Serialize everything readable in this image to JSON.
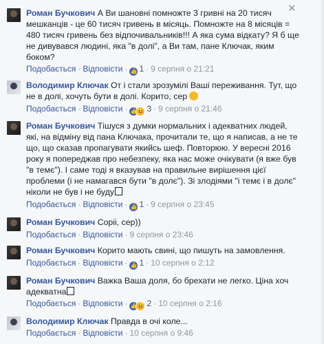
{
  "labels": {
    "like": "Подобається",
    "reply": "Відповісти"
  },
  "comments": [
    {
      "author": "Роман Бучкович",
      "text": "А Ви шановні помножте 3 гривні на 20 тисяч мешканців - це 60 тисяч гривень в місяць. Помножте на 8 місяців = 480 тисяч гривень без відпочивальників!!! А яка сума відкату? Я б ще не дивувався людині, яка \"в долі\", а Ви там, пане Ключак, яким боком?",
      "likes": "1",
      "time": "9 серпня о 21:21"
    },
    {
      "author": "Володимир Ключак",
      "text": "От і стали зрозумілі Ваші переживання. Тут, що не в долі, хочуть бути в долі. Корито, сер",
      "likes": "3",
      "time": "9 серпня о 21:46"
    },
    {
      "author": "Роман Бучкович",
      "text": "Тішуся з думки нормальних і адекватних людей, які, на відміну від пана Ключака, прочитали те, що я написав, а не те що, що сказав пропагувати якийсь шеф. Повторюю. У вересні 2016 року я попереджав про небезпеку, яка нас може очікувати (я вже був \"в темє\"). І саме тоді я вказував на правильне вирішення цієї проблеми (і не намагався бути \"в долє\"). Зі злодіями \"і темє і в долє\" ніколи не був і не буду",
      "likes": "1",
      "time": "9 серпня о 23:45"
    },
    {
      "author": "Роман Бучкович",
      "text": "Copii, сер))",
      "likes": "",
      "time": "9 серпня о 23:46"
    },
    {
      "author": "Роман Бучкович",
      "text": "Корито мають свині, що пишуть на замовлення.",
      "likes": "1",
      "time": "10 серпня о 2:12"
    },
    {
      "author": "Роман Бучкович",
      "text": "Важка Ваша доля, бо брехати не легко. Ціна хоч адекватна",
      "likes": "2",
      "time": "10 серпня о 2:16"
    },
    {
      "author": "Володимир Ключак",
      "text": "Правда в очі коле...",
      "likes": "",
      "time": "10 серпня о 9:46"
    }
  ]
}
